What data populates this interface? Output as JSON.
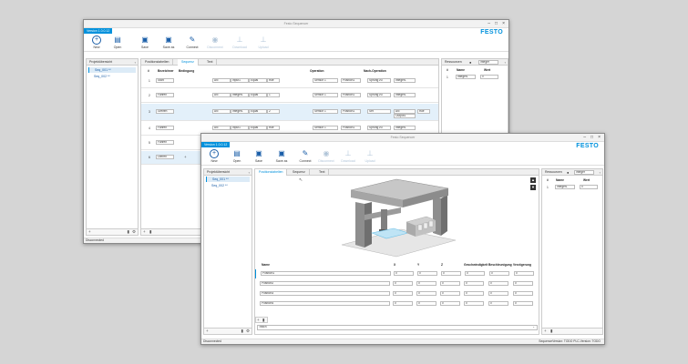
{
  "app": {
    "title": "Festo Sequencer",
    "version": "Version 1.0.0.12",
    "logo": "FESTO",
    "window_controls": [
      "–",
      "□",
      "×"
    ]
  },
  "toolbar": [
    {
      "label": "New",
      "icon": "plus-icon",
      "glyph": "+",
      "enabled": true
    },
    {
      "label": "Open",
      "icon": "folder-icon",
      "glyph": "▤",
      "enabled": true
    },
    {
      "label": "Save",
      "icon": "save-icon",
      "glyph": "▣",
      "enabled": true
    },
    {
      "label": "Save as",
      "icon": "save-as-icon",
      "glyph": "▣",
      "enabled": true
    },
    {
      "label": "Connect",
      "icon": "connect-icon",
      "glyph": "✎",
      "enabled": true
    },
    {
      "label": "Disconnect",
      "icon": "disconnect-icon",
      "glyph": "◉",
      "enabled": false
    },
    {
      "label": "Download",
      "icon": "download-icon",
      "glyph": "⊥",
      "enabled": false
    },
    {
      "label": "Upload",
      "icon": "upload-icon",
      "glyph": "⊥",
      "enabled": false
    }
  ],
  "project": {
    "header": "Projektübersicht",
    "items": [
      "Seq_001 **",
      "Seq_002 **"
    ]
  },
  "tabs": [
    "Positionstabellen",
    "Sequenz",
    "Text"
  ],
  "back_window": {
    "active_tab": 1,
    "columns": [
      "#",
      "Bezeichner",
      "Bedingung",
      "Operation",
      "Nach-Operation"
    ],
    "rows": [
      {
        "num": "1",
        "name": "Start",
        "c1": "AN",
        "c2": "Input1",
        "c3": "Equal",
        "c4": "true",
        "c5": "",
        "o1": "Sensor 1",
        "o2": "Position1",
        "n1": "Sprung zu",
        "n2": "Integer1"
      },
      {
        "num": "2",
        "name": "Fahren",
        "c1": "AN",
        "c2": "Integer1",
        "c3": "Equal",
        "c4": "1",
        "c5": "",
        "o1": "Sensor 1",
        "o2": "Position1",
        "n1": "Sprung zu",
        "n2": "Integer1"
      },
      {
        "num": "3",
        "name": "Greifen",
        "c1": "AN",
        "c2": "Integer1",
        "c3": "Equal",
        "c4": "2",
        "c5": "",
        "o1": "Sensor 1",
        "o2": "Position1",
        "n1": "Set",
        "n2": "AN",
        "n3": "Output1",
        "n4": "true"
      },
      {
        "num": "4",
        "name": "Fahren",
        "c1": "AN",
        "c2": "Input1",
        "c3": "Equal",
        "c4": "true",
        "c5": "",
        "o1": "Sensor 1",
        "o2": "Position1",
        "n1": "Sprung zu",
        "n2": "Integer1"
      },
      {
        "num": "5",
        "name": "Fahren",
        "c1": "",
        "c2": "",
        "c3": "",
        "c4": "",
        "c5": "",
        "o1": "",
        "o2": "",
        "n1": "",
        "n2": ""
      },
      {
        "num": "6",
        "name": "Leeren",
        "c1": "",
        "c2": "",
        "c3": "",
        "c4": "",
        "c5": "",
        "o1": "",
        "o2": "",
        "n1": "",
        "n2": ""
      }
    ],
    "status": "Disconnected"
  },
  "resources": {
    "header": "Ressourcen",
    "dropdown": "Integer",
    "columns": [
      "#",
      "Name",
      "Wert"
    ],
    "rows": [
      {
        "num": "1",
        "name": "Integer1",
        "value": "0"
      }
    ]
  },
  "front_window": {
    "active_tab": 0,
    "columns": [
      "Name",
      "X",
      "Y",
      "Z",
      "Geschwindigkeit",
      "Beschleunigung",
      "Verzögerung"
    ],
    "rows": [
      {
        "name": "Position1",
        "x": "0",
        "y": "0",
        "z": "0",
        "v": "0",
        "a": "0",
        "d": "0"
      },
      {
        "name": "Position2",
        "x": "0",
        "y": "0",
        "z": "0",
        "v": "0",
        "a": "0",
        "d": "0"
      },
      {
        "name": "Position3",
        "x": "0",
        "y": "0",
        "z": "0",
        "v": "0",
        "a": "0",
        "d": "0"
      },
      {
        "name": "Position4",
        "x": "0",
        "y": "0",
        "z": "0",
        "v": "0",
        "a": "0",
        "d": "0"
      }
    ],
    "teach_label": "Teach",
    "status": "Disconnected",
    "status_right": "SequenceVersion: TODO   PLC-Version: TODO"
  },
  "colors": {
    "accent": "#0091dc",
    "icon": "#1a5ea8",
    "background": "#d5d5d5"
  }
}
